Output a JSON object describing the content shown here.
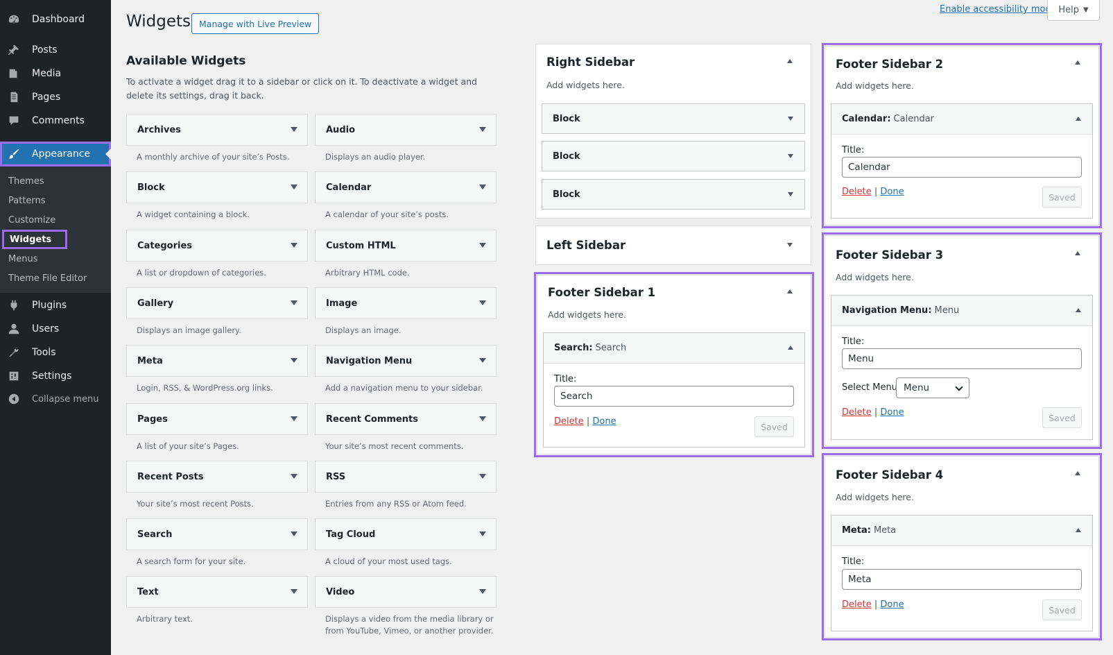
{
  "admin_menu": {
    "items": [
      {
        "label": "Dashboard",
        "icon": "dashboard-icon"
      },
      {
        "label": "Posts",
        "icon": "pin-icon"
      },
      {
        "label": "Media",
        "icon": "media-icon"
      },
      {
        "label": "Pages",
        "icon": "page-icon"
      },
      {
        "label": "Comments",
        "icon": "comment-icon"
      },
      {
        "label": "Appearance",
        "icon": "brush-icon"
      },
      {
        "label": "Plugins",
        "icon": "plug-icon"
      },
      {
        "label": "Users",
        "icon": "user-icon"
      },
      {
        "label": "Tools",
        "icon": "wrench-icon"
      },
      {
        "label": "Settings",
        "icon": "settings-icon"
      },
      {
        "label": "Collapse menu",
        "icon": "collapse-icon"
      }
    ],
    "submenu": [
      "Themes",
      "Patterns",
      "Customize",
      "Widgets",
      "Menus",
      "Theme File Editor"
    ]
  },
  "header": {
    "title": "Widgets",
    "live_preview": "Manage with Live Preview",
    "accessibility": "Enable accessibility mode",
    "help": "Help"
  },
  "available": {
    "title": "Available Widgets",
    "description": "To activate a widget drag it to a sidebar or click on it. To deactivate a widget and delete its settings, drag it back.",
    "widgets": [
      {
        "name": "Archives",
        "desc": "A monthly archive of your site’s Posts."
      },
      {
        "name": "Audio",
        "desc": "Displays an audio player."
      },
      {
        "name": "Block",
        "desc": "A widget containing a block."
      },
      {
        "name": "Calendar",
        "desc": "A calendar of your site’s posts."
      },
      {
        "name": "Categories",
        "desc": "A list or dropdown of categories."
      },
      {
        "name": "Custom HTML",
        "desc": "Arbitrary HTML code."
      },
      {
        "name": "Gallery",
        "desc": "Displays an image gallery."
      },
      {
        "name": "Image",
        "desc": "Displays an image."
      },
      {
        "name": "Meta",
        "desc": "Login, RSS, & WordPress.org links."
      },
      {
        "name": "Navigation Menu",
        "desc": "Add a navigation menu to your sidebar."
      },
      {
        "name": "Pages",
        "desc": "A list of your site’s Pages."
      },
      {
        "name": "Recent Comments",
        "desc": "Your site’s most recent comments."
      },
      {
        "name": "Recent Posts",
        "desc": "Your site’s most recent Posts."
      },
      {
        "name": "RSS",
        "desc": "Entries from any RSS or Atom feed."
      },
      {
        "name": "Search",
        "desc": "A search form for your site."
      },
      {
        "name": "Tag Cloud",
        "desc": "A cloud of your most used tags."
      },
      {
        "name": "Text",
        "desc": "Arbitrary text."
      },
      {
        "name": "Video",
        "desc": "Displays a video from the media library or from YouTube, Vimeo, or another provider."
      }
    ]
  },
  "sidebars": {
    "add_text": "Add widgets here.",
    "title_label": "Title:",
    "delete": "Delete",
    "separator": "|",
    "done": "Done",
    "saved": "Saved",
    "right": {
      "title": "Right Sidebar",
      "widgets": [
        "Block",
        "Block",
        "Block"
      ]
    },
    "left": {
      "title": "Left Sidebar"
    },
    "footer1": {
      "title": "Footer Sidebar 1",
      "widget_name": "Search",
      "widget_title": "Search",
      "title_value": "Search"
    },
    "footer2": {
      "title": "Footer Sidebar 2",
      "widget_name": "Calendar",
      "widget_title": "Calendar",
      "title_value": "Calendar"
    },
    "footer3": {
      "title": "Footer Sidebar 3",
      "widget_name": "Navigation Menu",
      "widget_title": "Menu",
      "title_value": "Menu",
      "select_label": "Select Menu:",
      "select_value": "Menu"
    },
    "footer4": {
      "title": "Footer Sidebar 4",
      "widget_name": "Meta",
      "widget_title": "Meta",
      "title_value": "Meta"
    }
  },
  "colors": {
    "accent": "#2271b1",
    "highlight": "#9b6bf2",
    "menu_bg": "#1d2327",
    "delete": "#d63638"
  }
}
